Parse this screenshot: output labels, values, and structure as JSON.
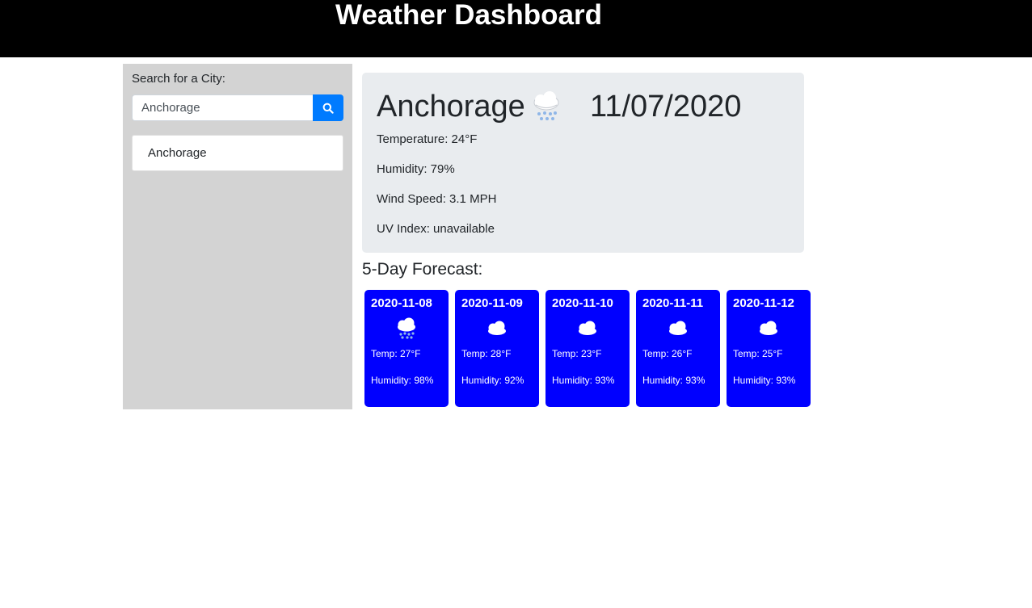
{
  "header": {
    "title": "Weather Dashboard"
  },
  "sidebar": {
    "search_label": "Search for a City:",
    "search_value": "Anchorage",
    "search_button_icon": "search-icon",
    "history": [
      "Anchorage"
    ]
  },
  "current": {
    "city": "Anchorage",
    "icon": "snow-cloud-icon",
    "date": "11/07/2020",
    "temperature": "Temperature: 24°F",
    "humidity": "Humidity: 79%",
    "wind_speed": "Wind Speed: 3.1 MPH",
    "uv_index": "UV Index: unavailable"
  },
  "forecast": {
    "heading": "5-Day Forecast:",
    "days": [
      {
        "date": "2020-11-08",
        "icon": "snow-cloud-icon",
        "temp": "Temp: 27°F",
        "humidity": "Humidity: 98%"
      },
      {
        "date": "2020-11-09",
        "icon": "cloud-icon",
        "temp": "Temp: 28°F",
        "humidity": "Humidity: 92%"
      },
      {
        "date": "2020-11-10",
        "icon": "cloud-icon",
        "temp": "Temp: 23°F",
        "humidity": "Humidity: 93%"
      },
      {
        "date": "2020-11-11",
        "icon": "cloud-icon",
        "temp": "Temp: 26°F",
        "humidity": "Humidity: 93%"
      },
      {
        "date": "2020-11-12",
        "icon": "cloud-icon",
        "temp": "Temp: 25°F",
        "humidity": "Humidity: 93%"
      }
    ]
  },
  "colors": {
    "header_bg": "#000000",
    "sidebar_bg": "#d3d3d3",
    "accent": "#007bff",
    "forecast_card_bg": "#0000ff",
    "current_card_bg": "#e9ecef"
  }
}
